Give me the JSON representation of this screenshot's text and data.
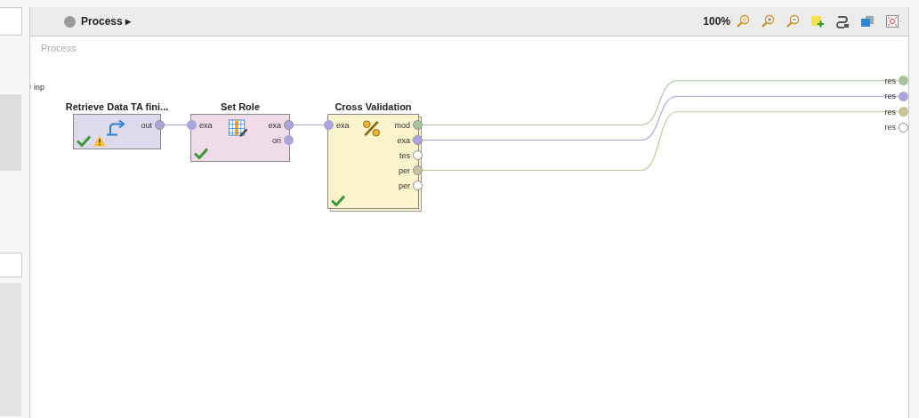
{
  "header": {
    "breadcrumb": "Process ▸",
    "zoom": "100%"
  },
  "canvas": {
    "title": "Process",
    "input_ports": [
      {
        "label": "inp"
      }
    ],
    "operators": [
      {
        "title": "Retrieve Data TA fini...",
        "kind": "retrieve",
        "color": "#dcdaeb",
        "valid": true,
        "warning": true,
        "outputs": [
          {
            "label": "out",
            "color": "#aaa6dc",
            "connected": true
          }
        ]
      },
      {
        "title": "Set Role",
        "kind": "set-role",
        "color": "#f0dbe8",
        "valid": true,
        "warning": false,
        "inputs": [
          {
            "label": "exa",
            "color": "#aaa6dc"
          }
        ],
        "outputs": [
          {
            "label": "exa",
            "color": "#aaa6dc",
            "connected": true
          },
          {
            "label": "ori",
            "color": "#aaa6dc",
            "connected": false
          }
        ]
      },
      {
        "title": "Cross Validation",
        "kind": "cross-validation",
        "color": "#faf3cc",
        "valid": true,
        "warning": false,
        "inputs": [
          {
            "label": "exa",
            "color": "#aaa6dc"
          }
        ],
        "outputs": [
          {
            "label": "mod",
            "color": "#a9c49c",
            "connected": true
          },
          {
            "label": "exa",
            "color": "#aaa6dc",
            "connected": true
          },
          {
            "label": "tes",
            "connected": false
          },
          {
            "label": "per",
            "color": "#c9c39c",
            "connected": true
          },
          {
            "label": "per",
            "connected": false
          }
        ]
      }
    ],
    "result_ports": [
      {
        "label": "res",
        "color": "#a9c49c"
      },
      {
        "label": "res",
        "color": "#aaa6dc"
      },
      {
        "label": "res",
        "color": "#c9c39c"
      },
      {
        "label": "res"
      }
    ]
  }
}
